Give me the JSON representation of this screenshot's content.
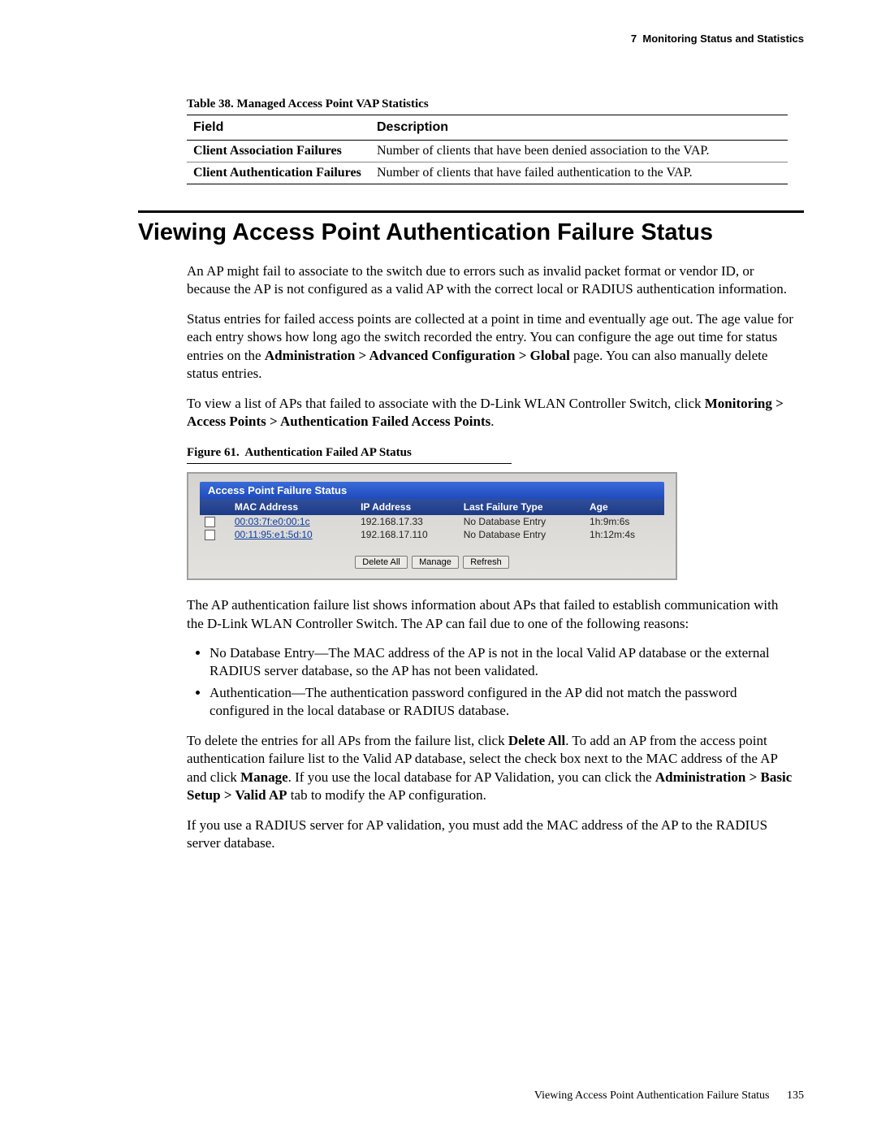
{
  "running_head": {
    "chapter_num": "7",
    "chapter_title": "Monitoring Status and Statistics"
  },
  "table38": {
    "label": "Table 38.",
    "title": "Managed Access Point VAP Statistics",
    "header_field": "Field",
    "header_desc": "Description",
    "rows": [
      {
        "field": "Client Association Failures",
        "desc": "Number of clients that have been denied association to the VAP."
      },
      {
        "field": "Client Authentication Failures",
        "desc": "Number of clients that have failed authentication to the VAP."
      }
    ]
  },
  "section_heading": "Viewing Access Point Authentication Failure Status",
  "para1": "An AP might fail to associate to the switch due to errors such as invalid packet format or vendor ID, or because the AP is not configured as a valid AP with the correct local or RADIUS authentication information.",
  "para2_a": "Status entries for failed access points are collected at a point in time and eventually age out. The age value for each entry shows how long ago the switch recorded the entry. You can configure the age out time for status entries on the ",
  "para2_b": "Administration > Advanced Configuration > Global",
  "para2_c": " page. You can also manually delete status entries.",
  "para3_a": "To view a list of APs that failed to associate with the D-Link WLAN Controller Switch, click ",
  "para3_b": "Monitoring > Access Points > Authentication Failed Access Points",
  "para3_c": ".",
  "figure61": {
    "label": "Figure 61.",
    "title": "Authentication Failed AP Status"
  },
  "screenshot": {
    "panel_title": "Access Point Failure Status",
    "headers": {
      "mac": "MAC Address",
      "ip": "IP Address",
      "type": "Last Failure Type",
      "age": "Age"
    },
    "rows": [
      {
        "mac": "00:03:7f:e0:00:1c",
        "ip": "192.168.17.33",
        "type": "No Database Entry",
        "age": "1h:9m:6s"
      },
      {
        "mac": "00:11:95:e1:5d:10",
        "ip": "192.168.17.110",
        "type": "No Database Entry",
        "age": "1h:12m:4s"
      }
    ],
    "buttons": {
      "delete_all": "Delete All",
      "manage": "Manage",
      "refresh": "Refresh"
    }
  },
  "para4": "The AP authentication failure list shows information about APs that failed to establish communication with the D-Link WLAN Controller Switch. The AP can fail due to one of the following reasons:",
  "bullets": [
    "No Database Entry—The MAC address of the AP is not in the local Valid AP database or the external RADIUS server database, so the AP has not been validated.",
    "Authentication—The authentication password configured in the AP did not match the password configured in the local database or RADIUS database."
  ],
  "para5_a": "To delete the entries for all APs from the failure list, click ",
  "para5_b": "Delete All",
  "para5_c": ". To add an AP from the access point authentication failure list to the Valid AP database, select the check box next to the MAC address of the AP and click ",
  "para5_d": "Manage",
  "para5_e": ". If you use the local database for AP Validation, you can click the ",
  "para5_f": "Administration > Basic Setup > Valid AP",
  "para5_g": " tab to modify the AP configuration.",
  "para6": "If you use a RADIUS server for AP validation, you must add the MAC address of the AP to the RADIUS server database.",
  "footer": {
    "title": "Viewing Access Point Authentication Failure Status",
    "page": "135"
  }
}
